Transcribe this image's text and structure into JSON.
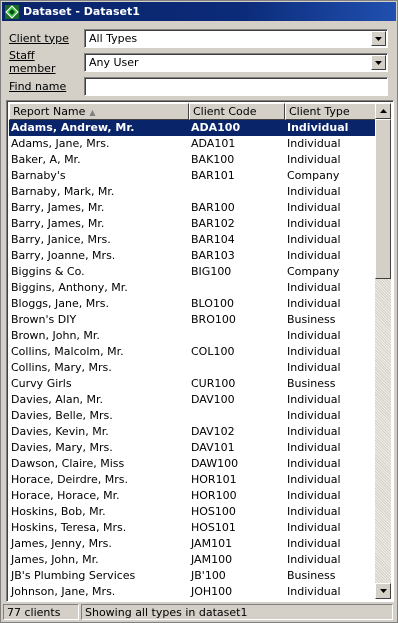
{
  "window": {
    "title": "Dataset - Dataset1"
  },
  "filters": {
    "client_type_label": "Client type",
    "client_type_value": "All Types",
    "staff_member_label": "Staff member",
    "staff_member_value": "Any User",
    "find_name_label": "Find name",
    "find_name_value": ""
  },
  "table": {
    "columns": [
      "Report Name",
      "Client Code",
      "Client Type"
    ],
    "sort_column": "Report Name",
    "selected_row": 0,
    "rows": [
      [
        "Adams, Andrew, Mr.",
        "ADA100",
        "Individual"
      ],
      [
        "Adams, Jane, Mrs.",
        "ADA101",
        "Individual"
      ],
      [
        "Baker, A, Mr.",
        "BAK100",
        "Individual"
      ],
      [
        "Barnaby's",
        "BAR101",
        "Company"
      ],
      [
        "Barnaby, Mark, Mr.",
        "",
        "Individual"
      ],
      [
        "Barry, James, Mr.",
        "BAR100",
        "Individual"
      ],
      [
        "Barry, James, Mr.",
        "BAR102",
        "Individual"
      ],
      [
        "Barry, Janice, Mrs.",
        "BAR104",
        "Individual"
      ],
      [
        "Barry, Joanne, Mrs.",
        "BAR103",
        "Individual"
      ],
      [
        "Biggins & Co.",
        "BIG100",
        "Company"
      ],
      [
        "Biggins, Anthony, Mr.",
        "",
        "Individual"
      ],
      [
        "Bloggs, Jane, Mrs.",
        "BLO100",
        "Individual"
      ],
      [
        "Brown's DIY",
        "BRO100",
        "Business"
      ],
      [
        "Brown, John, Mr.",
        "",
        "Individual"
      ],
      [
        "Collins, Malcolm, Mr.",
        "COL100",
        "Individual"
      ],
      [
        "Collins, Mary, Mrs.",
        "",
        "Individual"
      ],
      [
        "Curvy Girls",
        "CUR100",
        "Business"
      ],
      [
        "Davies, Alan, Mr.",
        "DAV100",
        "Individual"
      ],
      [
        "Davies, Belle, Mrs.",
        "",
        "Individual"
      ],
      [
        "Davies, Kevin, Mr.",
        "DAV102",
        "Individual"
      ],
      [
        "Davies, Mary, Mrs.",
        "DAV101",
        "Individual"
      ],
      [
        "Dawson, Claire, Miss",
        "DAW100",
        "Individual"
      ],
      [
        "Horace, Deirdre, Mrs.",
        "HOR101",
        "Individual"
      ],
      [
        "Horace, Horace, Mr.",
        "HOR100",
        "Individual"
      ],
      [
        "Hoskins, Bob, Mr.",
        "HOS100",
        "Individual"
      ],
      [
        "Hoskins, Teresa, Mrs.",
        "HOS101",
        "Individual"
      ],
      [
        "James, Jenny, Mrs.",
        "JAM101",
        "Individual"
      ],
      [
        "James, John, Mr.",
        "JAM100",
        "Individual"
      ],
      [
        "JB's Plumbing Services",
        "JB'100",
        "Business"
      ],
      [
        "Johnson, Jane, Mrs.",
        "JOH100",
        "Individual"
      ]
    ]
  },
  "status": {
    "count": "77 clients",
    "message": "Showing all types in dataset1"
  },
  "colors": {
    "titlebar": "#0a246a",
    "selection": "#0a246a",
    "face": "#d4d0c8"
  }
}
